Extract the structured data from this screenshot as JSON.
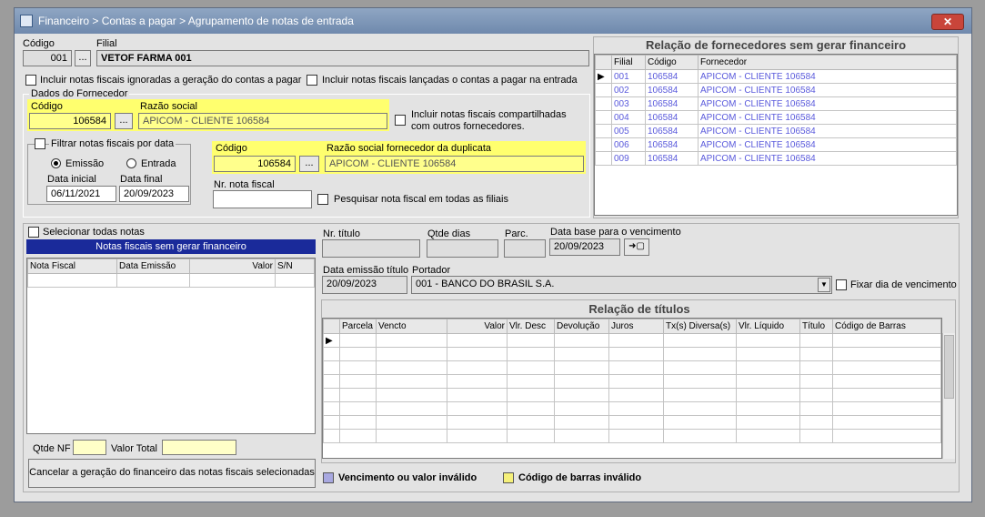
{
  "window": {
    "title": "Financeiro > Contas a pagar > Agrupamento de notas de entrada",
    "close_label": "✕"
  },
  "header": {
    "codigo_label": "Código",
    "codigo_value": "001",
    "filial_label": "Filial",
    "filial_value": "VETOF FARMA 001",
    "browse_label": "...",
    "chk_ignoradas": "Incluir notas fiscais ignoradas a geração do contas a pagar",
    "chk_lancadas": "Incluir notas fiscais lançadas o contas a pagar na entrada"
  },
  "fornecedor": {
    "group_title": "Dados do Fornecedor",
    "codigo_label": "Código",
    "codigo_value": "106584",
    "razao_label": "Razão social",
    "razao_value": "APICOM - CLIENTE 106584",
    "chk_compartilhadas": "Incluir notas fiscais compartilhadas com outros fornecedores.",
    "filtrar_label": "Filtrar notas fiscais por data",
    "radio_emissao": "Emissão",
    "radio_entrada": "Entrada",
    "data_inicial_label": "Data inicial",
    "data_inicial_value": "06/11/2021",
    "data_final_label": "Data final",
    "data_final_value": "20/09/2023",
    "dup_codigo_label": "Código",
    "dup_codigo_value": "106584",
    "dup_razao_label": "Razão social fornecedor da duplicata",
    "dup_razao_value": "APICOM - CLIENTE 106584",
    "nr_nota_label": "Nr. nota fiscal",
    "nr_nota_value": "",
    "chk_todas_filiais": "Pesquisar nota fiscal em todas as filiais"
  },
  "fornecedores_sem_financeiro": {
    "title": "Relação de fornecedores sem gerar financeiro",
    "columns": [
      "Filial",
      "Código",
      "Fornecedor"
    ],
    "rows": [
      [
        "001",
        "106584",
        "APICOM - CLIENTE 106584"
      ],
      [
        "002",
        "106584",
        "APICOM - CLIENTE 106584"
      ],
      [
        "003",
        "106584",
        "APICOM - CLIENTE 106584"
      ],
      [
        "004",
        "106584",
        "APICOM - CLIENTE 106584"
      ],
      [
        "005",
        "106584",
        "APICOM - CLIENTE 106584"
      ],
      [
        "006",
        "106584",
        "APICOM - CLIENTE 106584"
      ],
      [
        "009",
        "106584",
        "APICOM - CLIENTE 106584"
      ]
    ]
  },
  "notas": {
    "chk_selecionar_todas": "Selecionar todas notas",
    "title": "Notas fiscais sem gerar financeiro",
    "columns": [
      "Nota Fiscal",
      "Data Emissão",
      "Valor",
      "S/N"
    ],
    "qtde_nf_label": "Qtde NF",
    "valor_total_label": "Valor Total",
    "cancel_button": "Cancelar a geração do financeiro das notas fiscais selecionadas"
  },
  "titulo": {
    "nr_titulo_label": "Nr. título",
    "qtde_dias_label": "Qtde dias",
    "parc_label": "Parc.",
    "data_base_label": "Data base para o vencimento",
    "data_base_value": "20/09/2023",
    "apply_button": "➜▢",
    "data_emissao_label": "Data emissão título",
    "data_emissao_value": "20/09/2023",
    "portador_label": "Portador",
    "portador_value": "001 - BANCO DO BRASIL S.A.",
    "chk_fixar": "Fixar dia de vencimento"
  },
  "titulos": {
    "title": "Relação de títulos",
    "columns": [
      "Parcela",
      "Vencto",
      "Valor",
      "Vlr. Desc",
      "Devolução",
      "Juros",
      "Tx(s) Diversa(s)",
      "Vlr. Líquido",
      "Título",
      "Código de Barras"
    ]
  },
  "legend": {
    "invalid_due": "Vencimento ou valor inválido",
    "invalid_barcode": "Código de barras inválido",
    "color_due": "#a8a8e0",
    "color_barcode": "#f5f07a"
  }
}
